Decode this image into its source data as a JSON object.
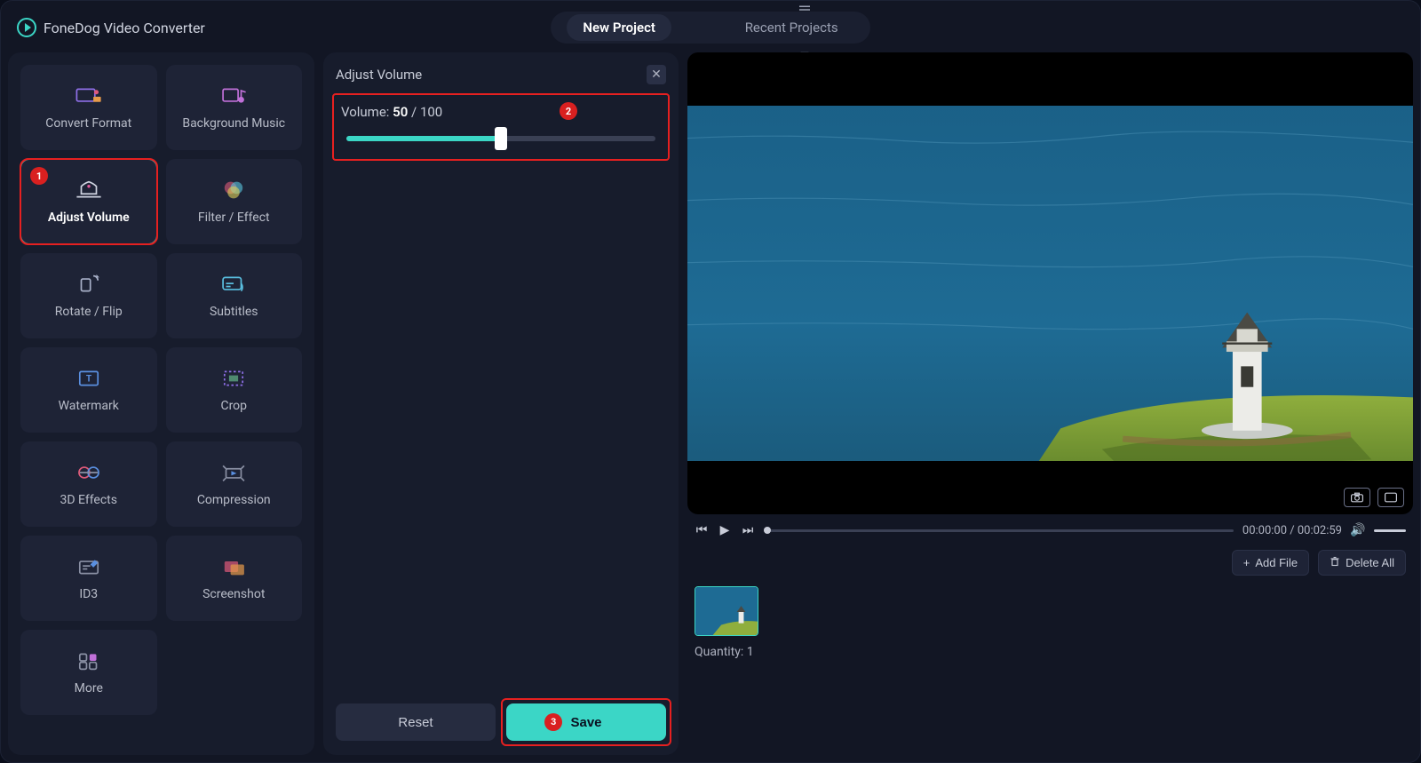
{
  "app": {
    "title": "FoneDog Video Converter"
  },
  "tabs": {
    "new_project": "New Project",
    "recent_projects": "Recent Projects"
  },
  "sidebar": {
    "items": [
      {
        "label": "Convert Format"
      },
      {
        "label": "Background Music"
      },
      {
        "label": "Adjust Volume"
      },
      {
        "label": "Filter / Effect"
      },
      {
        "label": "Rotate / Flip"
      },
      {
        "label": "Subtitles"
      },
      {
        "label": "Watermark"
      },
      {
        "label": "Crop"
      },
      {
        "label": "3D Effects"
      },
      {
        "label": "Compression"
      },
      {
        "label": "ID3"
      },
      {
        "label": "Screenshot"
      },
      {
        "label": "More"
      }
    ]
  },
  "panel": {
    "title": "Adjust Volume",
    "volume_prefix": "Volume: ",
    "volume_current": "50",
    "volume_sep": " / ",
    "volume_max": "100",
    "reset": "Reset",
    "save": "Save"
  },
  "annotations": {
    "one": "1",
    "two": "2",
    "three": "3"
  },
  "player": {
    "time_current": "00:00:00",
    "time_sep": " / ",
    "time_total": "00:02:59"
  },
  "filebar": {
    "add_file": "Add File",
    "delete_all": "Delete All"
  },
  "footer": {
    "quantity_label": "Quantity: ",
    "quantity_value": "1"
  },
  "colors": {
    "accent": "#3bd6c6",
    "annotation": "#e62020"
  }
}
